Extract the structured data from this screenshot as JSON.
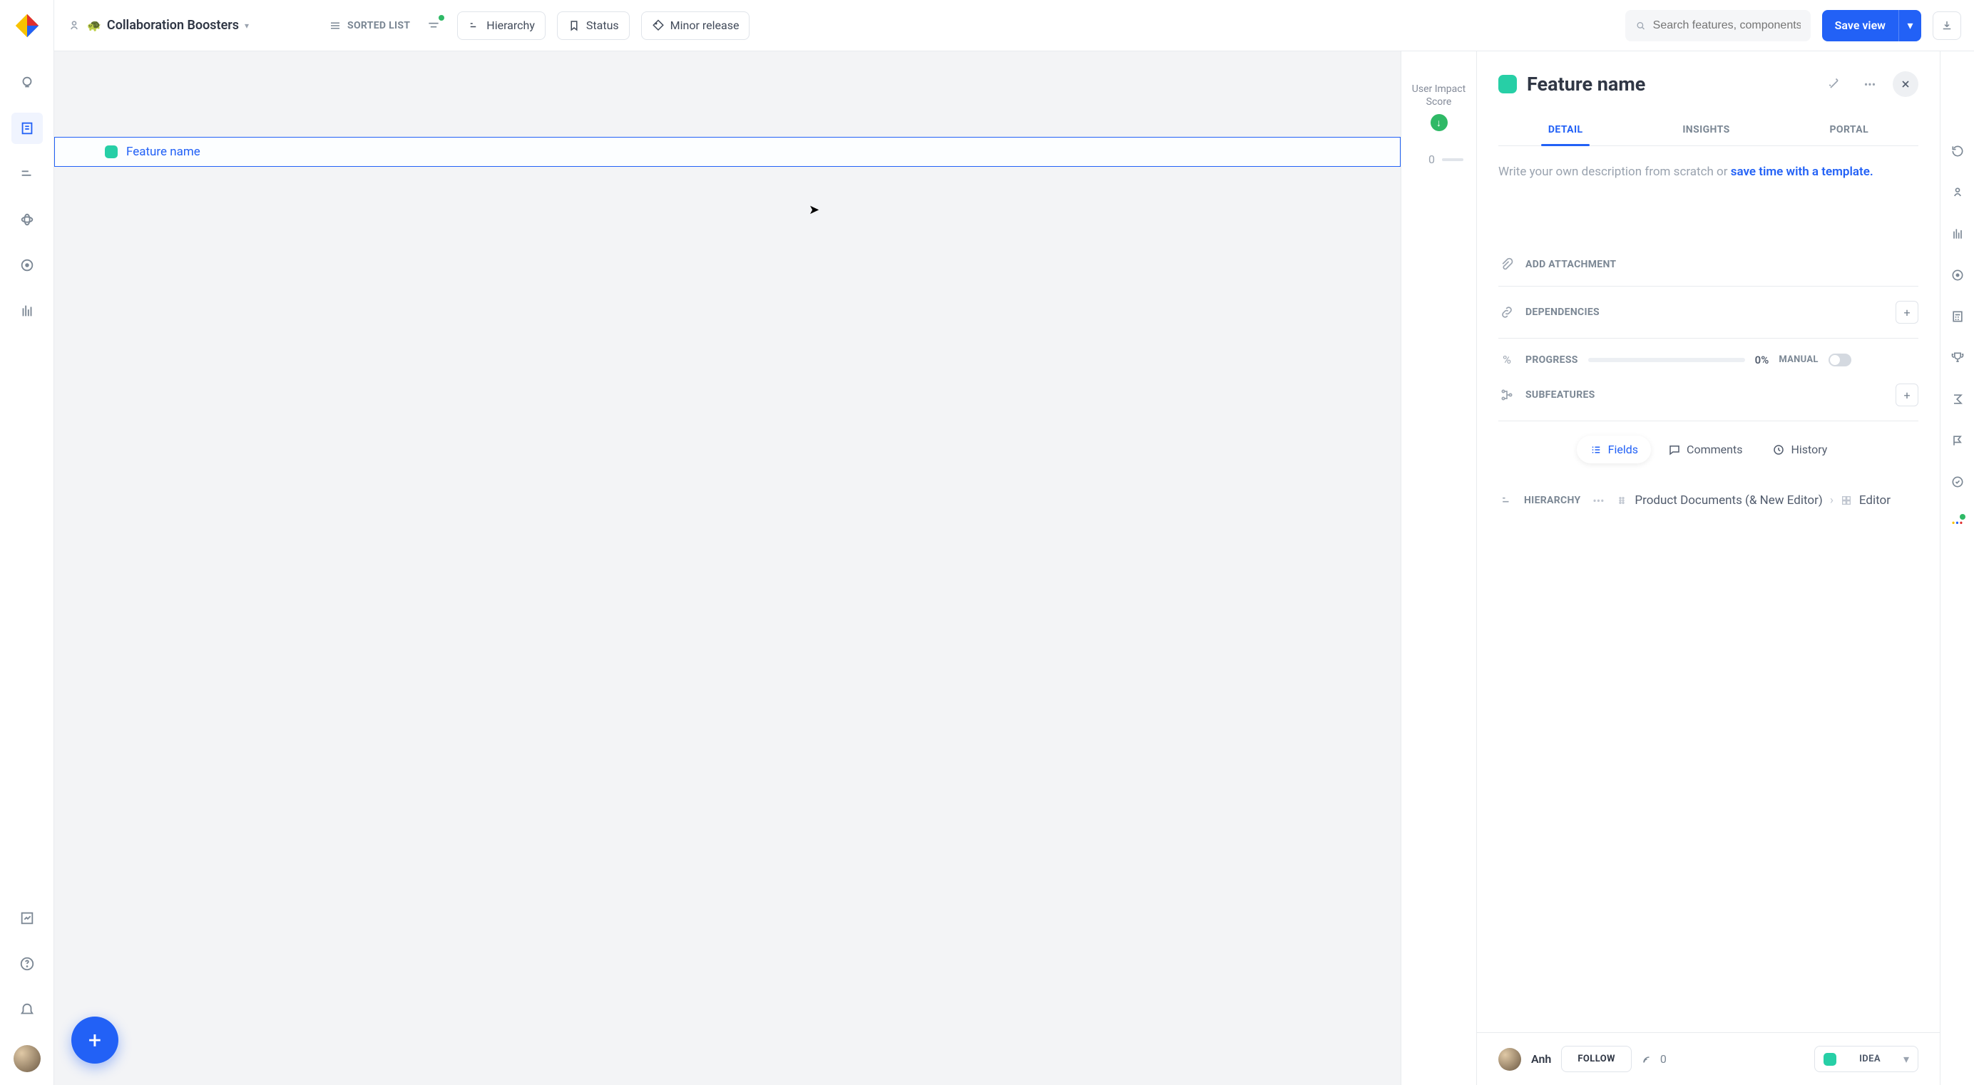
{
  "topbar": {
    "project_emoji": "🐢",
    "project_title": "Collaboration Boosters",
    "sorted_list": "SORTED LIST",
    "filters": {
      "hierarchy": "Hierarchy",
      "status": "Status",
      "minor_release": "Minor release"
    },
    "search_placeholder": "Search features, components",
    "save_view": "Save view"
  },
  "list": {
    "score_column": "User Impact Score",
    "row_title": "Feature name",
    "row_score": "0"
  },
  "panel": {
    "title": "Feature name",
    "tabs": {
      "detail": "DETAIL",
      "insights": "INSIGHTS",
      "portal": "PORTAL"
    },
    "desc_hint": "Write your own description from scratch or ",
    "desc_link": "save time with a template.",
    "attachment": "ADD ATTACHMENT",
    "dependencies": "DEPENDENCIES",
    "progress_label": "PROGRESS",
    "progress_value": "0%",
    "manual": "MANUAL",
    "subfeatures": "SUBFEATURES",
    "pill_fields": "Fields",
    "pill_comments": "Comments",
    "pill_history": "History",
    "hierarchy_label": "HIERARCHY",
    "hierarchy_parent": "Product Documents (& New Editor)",
    "hierarchy_leaf": "Editor",
    "owner_name": "Anh",
    "follow": "FOLLOW",
    "signal_count": "0",
    "status": "IDEA"
  }
}
